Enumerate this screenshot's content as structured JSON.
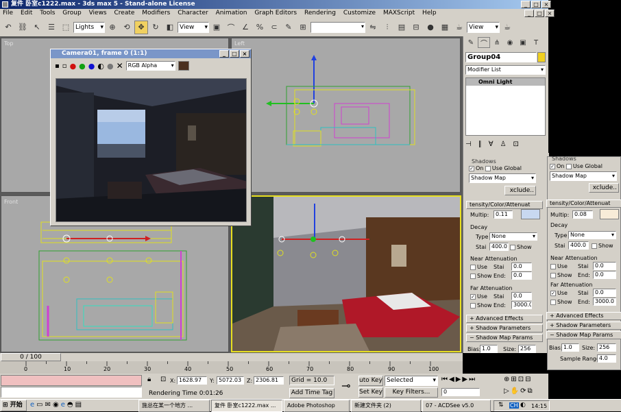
{
  "window": {
    "title": "复件 卧室c1222.max - 3ds max 5 - Stand-alone License"
  },
  "menu": [
    "File",
    "Edit",
    "Tools",
    "Group",
    "Views",
    "Create",
    "Modifiers",
    "Character",
    "Animation",
    "Graph Editors",
    "Rendering",
    "Customize",
    "MAXScript",
    "Help"
  ],
  "toolbar": {
    "selection_filter": "Lights",
    "ref_coord": "View",
    "render_type": "View"
  },
  "viewports": {
    "top": "Top",
    "left": "Left",
    "front": "Front",
    "persp": "Camera01"
  },
  "render_window": {
    "title": "Camera01, frame 0 (1:1)",
    "channel": "RGB Alpha"
  },
  "command_panel": {
    "object_name": "Group04",
    "modifier_list": "Modifier List",
    "stack_item": "Omni Light"
  },
  "shadows": {
    "title": "Shadows",
    "on_label": "On",
    "use_global": "Use Global",
    "shadow_type": "Shadow Map",
    "exclude": "xclude.."
  },
  "intensity": {
    "title": "tensity/Color/Attenuat",
    "multiplier_label": "Multip:",
    "multiplier_main": "0.11",
    "multiplier_side": "0.08"
  },
  "decay": {
    "title": "Decay",
    "type_label": "Type",
    "type_value": "None",
    "start_label": "Stai",
    "start_value": "400.0",
    "show": "Show"
  },
  "near": {
    "title": "Near Attenuation",
    "use": "Use",
    "show": "Show",
    "start_label": "Stai",
    "end_label": "End:",
    "start": "0.0",
    "end": "0.0"
  },
  "far": {
    "title": "Far Attenuation",
    "use": "Use",
    "show": "Show",
    "start_label": "Stai",
    "end_label": "End:",
    "start": "0.0",
    "end": "3000.0"
  },
  "rollouts": {
    "advanced": "Advanced Effects",
    "shadow_params": "Shadow Parameters",
    "shadow_map": "Shadow Map Params"
  },
  "shadow_map": {
    "bias_label": "Bias:",
    "bias": "1.0",
    "size_label": "Size:",
    "size": "256",
    "range_label": "Sample Range:",
    "range": "4.0"
  },
  "timeline": {
    "frame": "0 / 100",
    "ticks": [
      "0",
      "10",
      "20",
      "30",
      "40",
      "50",
      "60",
      "70",
      "80",
      "90",
      "100"
    ]
  },
  "status": {
    "x_label": "X:",
    "x": "1628.97",
    "y_label": "Y:",
    "y": "5072.03",
    "z_label": "Z:",
    "z": "2306.81",
    "grid": "Grid = 10.0",
    "auto_key": "uto Key",
    "set_key": "Set Key",
    "selected": "Selected",
    "key_filters": "Key Filters...",
    "prompt": "Rendering Time  0:01:26",
    "add_time_tag": "Add Time Tag",
    "frame_field": "0"
  },
  "taskbar": {
    "start": "开始",
    "items": [
      "施总在某一个地方 ...",
      "复件 卧室c1222.max ...",
      "Adobe Photoshop",
      "新建文件夹 (2)",
      "07 - ACDSee v5.0"
    ],
    "ime": "CH",
    "clock": "14:15"
  },
  "colors": {
    "viewport_gray": "#a8a8a8",
    "title_blue": "#0a246a",
    "multiplier_swatch_main": "#c8d8f0",
    "multiplier_swatch_side": "#f8ecd8"
  }
}
